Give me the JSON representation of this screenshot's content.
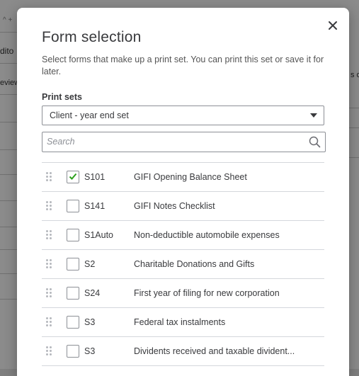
{
  "background": {
    "left_fragments": [
      "^ +",
      "dito",
      "eview"
    ],
    "right_fragments": [
      "s o"
    ]
  },
  "modal": {
    "title": "Form selection",
    "description": "Select forms that make up a print set. You can print this set or save it for later.",
    "close_icon": "close-icon",
    "print_sets": {
      "label": "Print sets",
      "selected": "Client - year end set"
    },
    "search": {
      "placeholder": "Search",
      "value": ""
    },
    "forms": [
      {
        "code": "S101",
        "name": "GIFI Opening Balance Sheet",
        "checked": true
      },
      {
        "code": "S141",
        "name": "GIFI Notes Checklist",
        "checked": false
      },
      {
        "code": "S1Auto",
        "name": "Non-deductible automobile expenses",
        "checked": false
      },
      {
        "code": "S2",
        "name": "Charitable Donations and Gifts",
        "checked": false
      },
      {
        "code": "S24",
        "name": "First year of filing for new corporation",
        "checked": false
      },
      {
        "code": "S3",
        "name": "Federal tax instalments",
        "checked": false
      },
      {
        "code": "S3",
        "name": "Dividents received and taxable divident...",
        "checked": false
      }
    ]
  },
  "colors": {
    "check": "#2ca01c",
    "text": "#393a3d",
    "border": "#8d9096"
  }
}
